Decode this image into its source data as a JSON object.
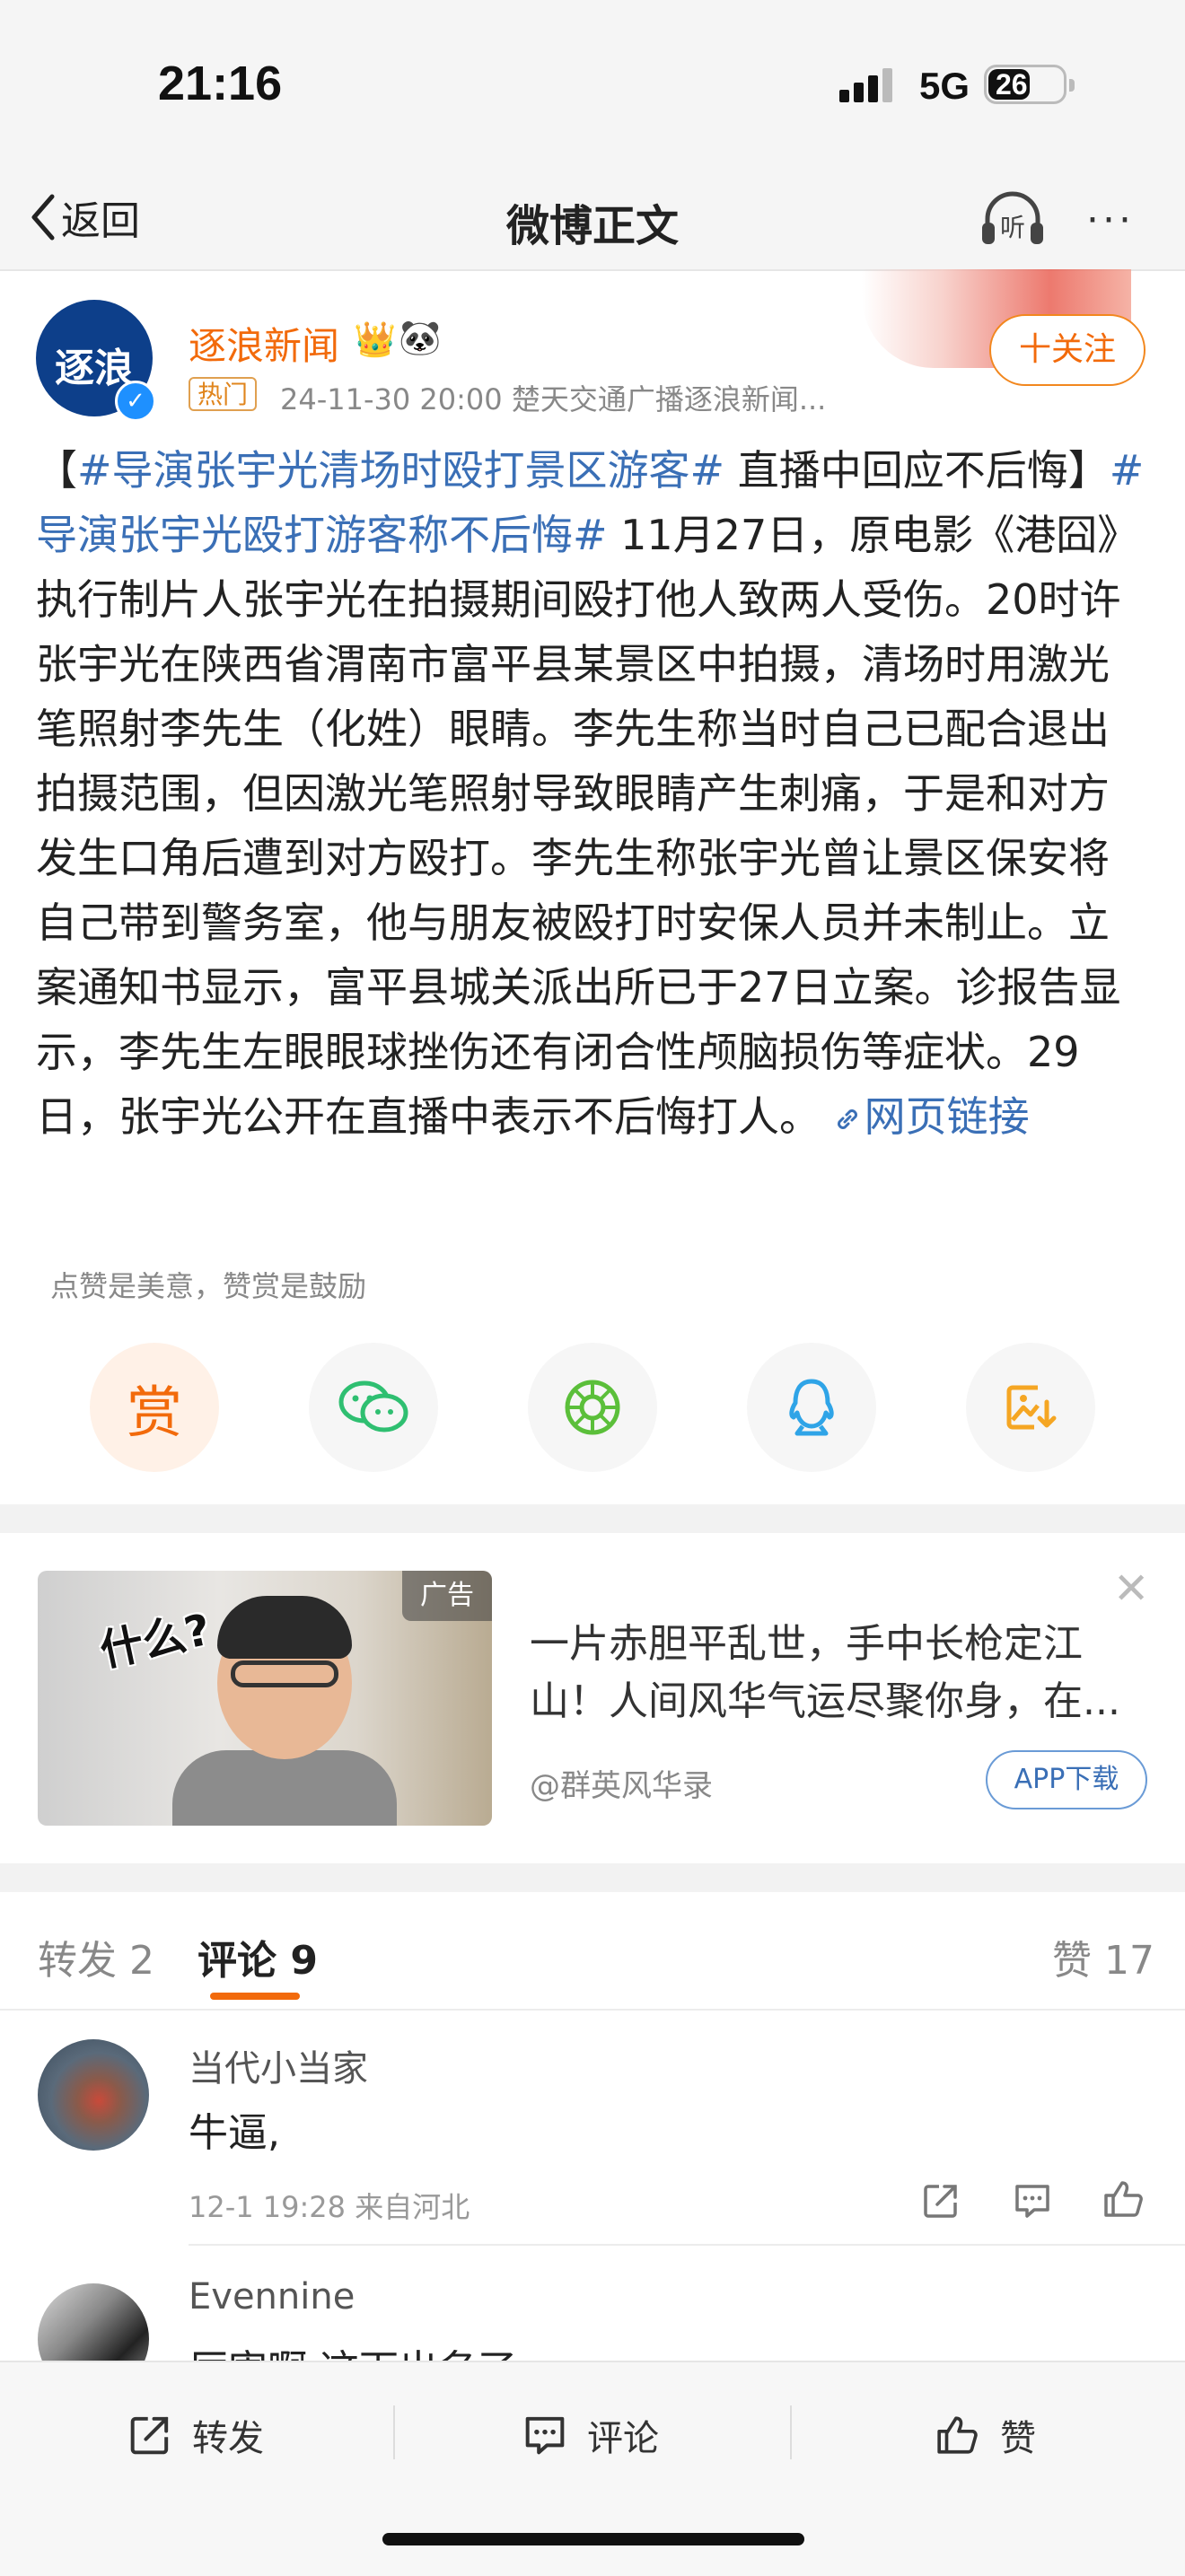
{
  "status_bar": {
    "time": "21:16",
    "network": "5G",
    "battery": "26"
  },
  "nav": {
    "back_label": "返回",
    "title": "微博正文",
    "listen_label": "听"
  },
  "post": {
    "avatar_text": "逐浪",
    "author": "逐浪新闻",
    "hot_tag": "热门",
    "meta": "24-11-30 20:00  楚天交通广播逐浪新闻...",
    "follow_label": "十关注",
    "body": {
      "bracket_open": "【",
      "topic1": "#导演张宇光清场时殴打景区游客#",
      "title_rest": " 直播中回应不后悔】",
      "topic2": "#导演张宇光殴打游客称不后悔#",
      "text": " 11月27日，原电影《港囧》执行制片人张宇光在拍摄期间殴打他人致两人受伤。20时许 张宇光在陕西省渭南市富平县某景区中拍摄，清场时用激光笔照射李先生（化姓）眼睛。李先生称当时自己已配合退出拍摄范围，但因激光笔照射导致眼睛产生刺痛，于是和对方发生口角后遭到对方殴打。李先生称张宇光曾让景区保安将自己带到警务室，他与朋友被殴打时安保人员并未制止。立案通知书显示，富平县城关派出所已于27日立案。诊报告显示，李先生左眼眼球挫伤还有闭合性颅脑损伤等症状。29日，张宇光公开在直播中表示不后悔打人。 ",
      "link": "网页链接"
    },
    "tip": "点赞是美意，赞赏是鼓励",
    "reward_label": "赏"
  },
  "ad": {
    "tag": "广告",
    "speech": "什么?",
    "line1": "一片赤胆平乱世，手中长枪定江",
    "line2": "山！人间风华气运尽聚你身，在...",
    "source": "@群英风华录",
    "app_label": "APP下载"
  },
  "tabs": {
    "repost": "转发 2",
    "comment": "评论 9",
    "like": "赞 17"
  },
  "comments": [
    {
      "name": "当代小当家",
      "text": "牛逼,",
      "meta": "12-1 19:28  来自河北"
    },
    {
      "name": "Evennine",
      "text": "厉害啊 这下出名了"
    }
  ],
  "toolbar": {
    "repost": "转发",
    "comment": "评论",
    "like": "赞"
  },
  "colors": {
    "accent": "#f26a0b",
    "link": "#3a6fb6"
  }
}
